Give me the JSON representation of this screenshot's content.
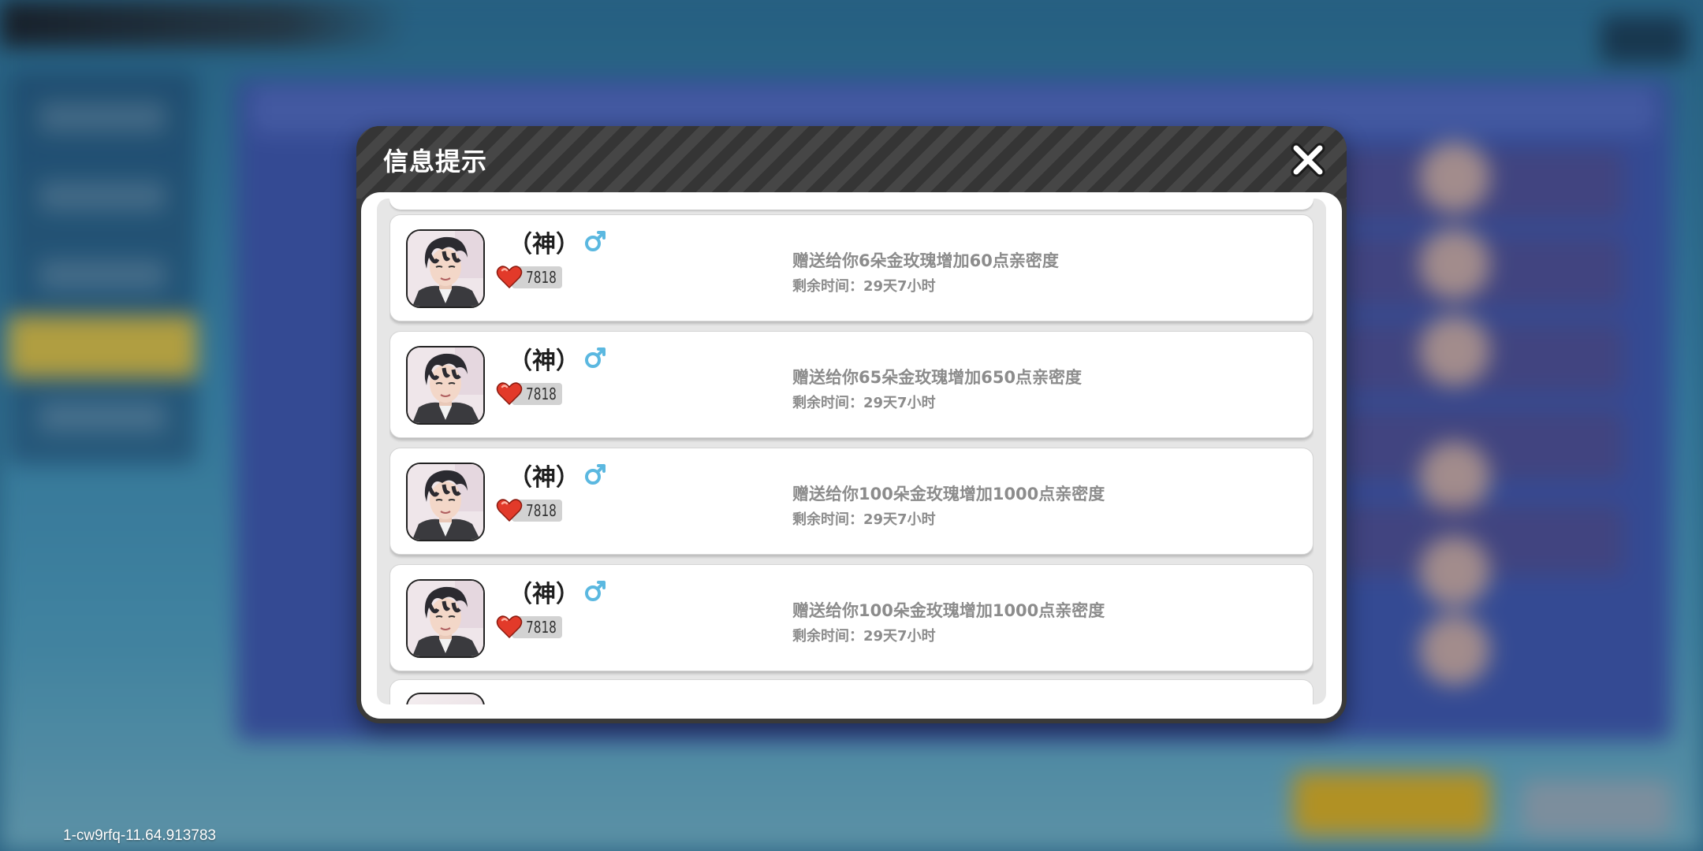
{
  "dialog": {
    "title": "信息提示",
    "close_icon": "close-icon"
  },
  "messages": [
    {
      "name": "（神）",
      "gender": "male",
      "intimacy": "7818",
      "gift_text": "赠送给你6朵金玫瑰增加60点亲密度",
      "remaining": "剩余时间：29天7小时"
    },
    {
      "name": "（神）",
      "gender": "male",
      "intimacy": "7818",
      "gift_text": "赠送给你65朵金玫瑰增加650点亲密度",
      "remaining": "剩余时间：29天7小时"
    },
    {
      "name": "（神）",
      "gender": "male",
      "intimacy": "7818",
      "gift_text": "赠送给你100朵金玫瑰增加1000点亲密度",
      "remaining": "剩余时间：29天7小时"
    },
    {
      "name": "（神）",
      "gender": "male",
      "intimacy": "7818",
      "gift_text": "赠送给你100朵金玫瑰增加1000点亲密度",
      "remaining": "剩余时间：29天7小时"
    }
  ],
  "build_id": "1-cw9rfq-11.64.913783",
  "colors": {
    "gender_male": "#5bb8e0",
    "heart": "#e23a2a",
    "muted_text": "#8c8c8c"
  }
}
